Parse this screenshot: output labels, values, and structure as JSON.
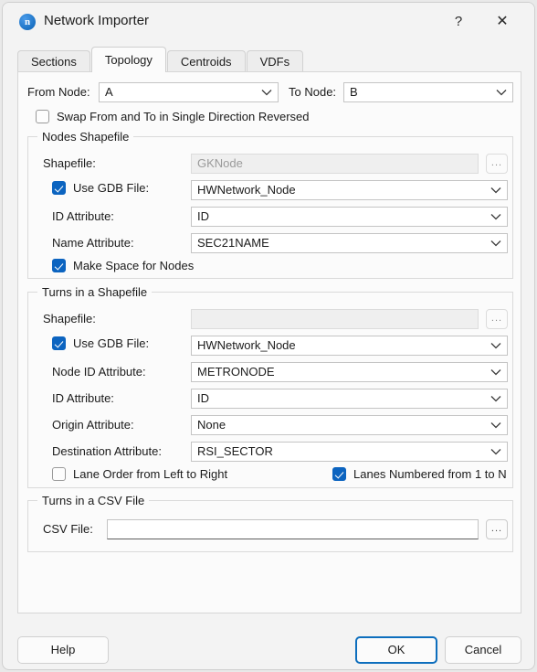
{
  "window": {
    "title": "Network Importer",
    "icon": "network-importer-icon",
    "icon_letter": "n",
    "help_glyph": "?",
    "close_glyph": "✕",
    "accent_color": "#0d6ebd",
    "checkbox_color": "#0c64c0"
  },
  "tabs": [
    {
      "label": "Sections",
      "active": false
    },
    {
      "label": "Topology",
      "active": true
    },
    {
      "label": "Centroids",
      "active": false
    },
    {
      "label": "VDFs",
      "active": false
    }
  ],
  "topology": {
    "from_node": {
      "label": "From Node:",
      "value": "A"
    },
    "to_node": {
      "label": "To Node:",
      "value": "B"
    },
    "swap_checkbox": {
      "label": "Swap From and To in Single Direction Reversed",
      "checked": false
    },
    "nodes_shapefile": {
      "title": "Nodes Shapefile",
      "shapefile": {
        "label": "Shapefile:",
        "value": "GKNode",
        "enabled": false
      },
      "browse_label": "...",
      "use_gdb": {
        "label": "Use GDB File:",
        "checked": true,
        "value": "HWNetwork_Node"
      },
      "id_attribute": {
        "label": "ID Attribute:",
        "value": "ID"
      },
      "name_attribute": {
        "label": "Name Attribute:",
        "value": "SEC21NAME"
      },
      "make_space": {
        "label": "Make Space for Nodes",
        "checked": true
      }
    },
    "turns_shapefile": {
      "title": "Turns in a Shapefile",
      "shapefile": {
        "label": "Shapefile:",
        "value": "",
        "enabled": false
      },
      "browse_label": "...",
      "use_gdb": {
        "label": "Use GDB File:",
        "checked": true,
        "value": "HWNetwork_Node"
      },
      "node_id_attribute": {
        "label": "Node ID Attribute:",
        "value": "METRONODE"
      },
      "id_attribute": {
        "label": "ID Attribute:",
        "value": "ID"
      },
      "origin_attribute": {
        "label": "Origin Attribute:",
        "value": "None"
      },
      "destination_attribute": {
        "label": "Destination Attribute:",
        "value": "RSI_SECTOR"
      },
      "lane_order": {
        "label": "Lane Order from Left to Right",
        "checked": false
      },
      "lanes_numbered": {
        "label": "Lanes Numbered from 1 to N",
        "checked": true
      }
    },
    "turns_csv": {
      "title": "Turns in a CSV File",
      "csv_file": {
        "label": "CSV File:",
        "value": ""
      },
      "browse_label": "..."
    }
  },
  "footer": {
    "help": "Help",
    "ok": "OK",
    "cancel": "Cancel"
  }
}
